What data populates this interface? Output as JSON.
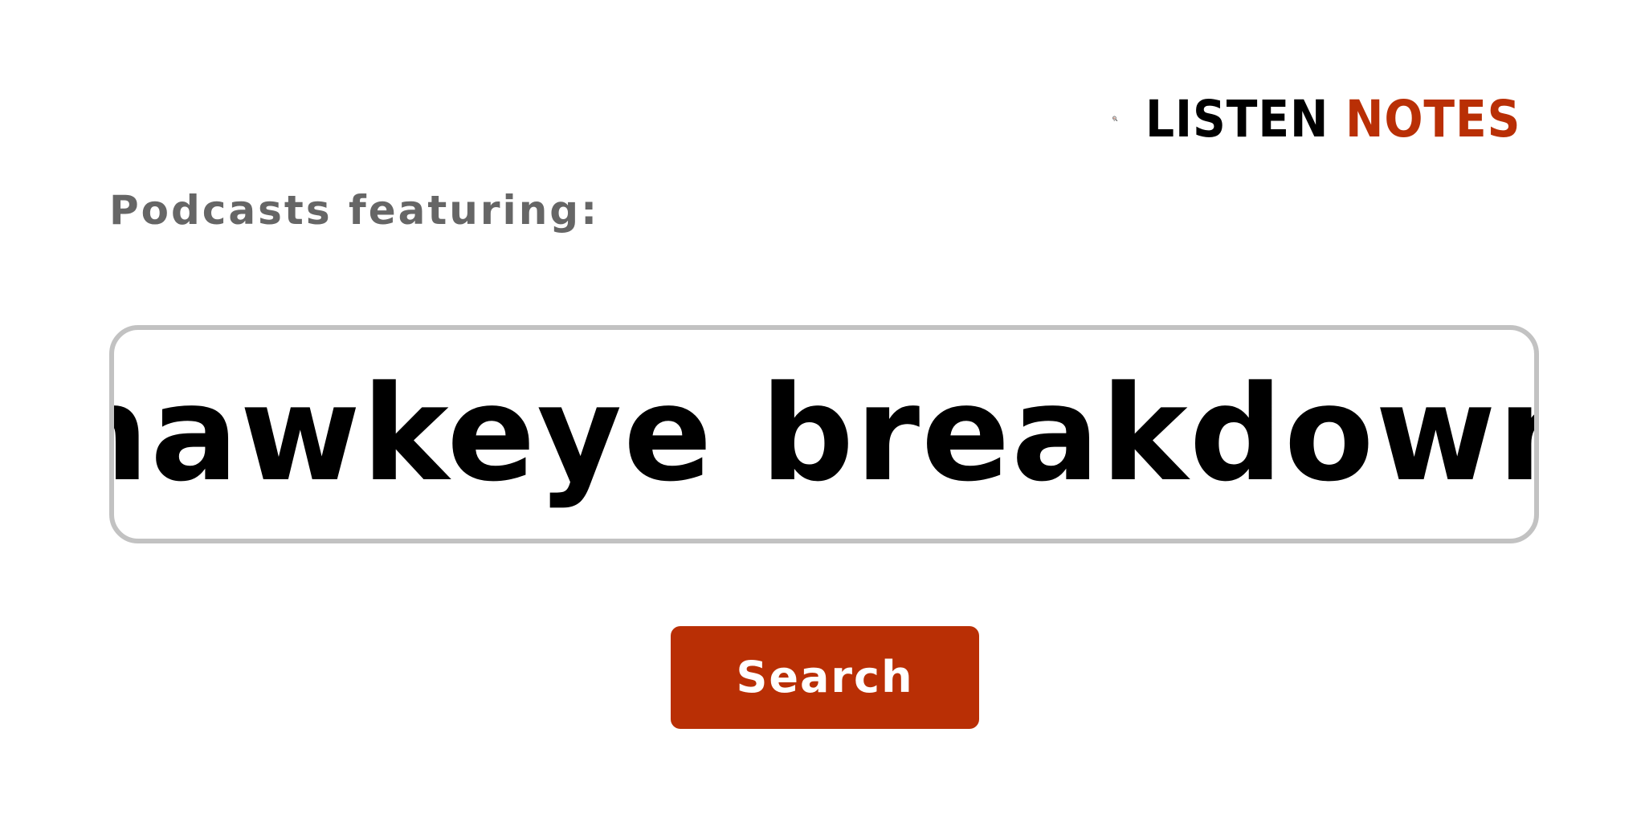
{
  "brand": {
    "icon": "podcast-search-icon",
    "word1": "LISTEN",
    "word2": "NOTES",
    "accent_color": "#b92f05"
  },
  "heading": "Podcasts featuring:",
  "search": {
    "value": "hawkeye breakdown"
  },
  "actions": {
    "search_label": "Search",
    "button_color": "#b92f05"
  }
}
